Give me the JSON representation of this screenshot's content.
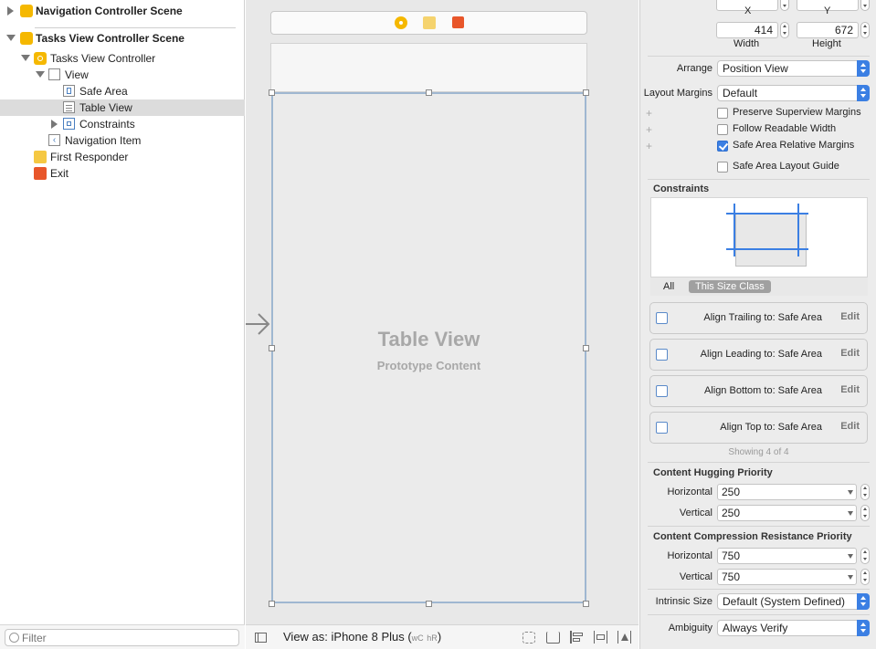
{
  "outline": {
    "items": [
      {
        "label": "Navigation Controller Scene"
      },
      {
        "label": "Tasks View Controller Scene"
      },
      {
        "label": "Tasks View Controller"
      },
      {
        "label": "View"
      },
      {
        "label": "Safe Area"
      },
      {
        "label": "Table View"
      },
      {
        "label": "Constraints"
      },
      {
        "label": "Navigation Item"
      },
      {
        "label": "First Responder"
      },
      {
        "label": "Exit"
      }
    ],
    "filter_placeholder": "Filter"
  },
  "canvas": {
    "table_title": "Table View",
    "table_subtitle": "Prototype Content",
    "view_as_text": "View as: iPhone 8 Plus (",
    "size_w": "wC",
    "size_h": "hR",
    "close_paren": ")"
  },
  "inspector": {
    "x_label": "X",
    "y_label": "Y",
    "width_value": "414",
    "height_value": "672",
    "width_label": "Width",
    "height_label": "Height",
    "arrange_label": "Arrange",
    "arrange_value": "Position View",
    "layout_margins_label": "Layout Margins",
    "layout_margins_value": "Default",
    "checks": [
      {
        "label": "Preserve Superview Margins",
        "checked": false
      },
      {
        "label": "Follow Readable Width",
        "checked": false
      },
      {
        "label": "Safe Area Relative Margins",
        "checked": true
      },
      {
        "label": "Safe Area Layout Guide",
        "checked": false
      }
    ],
    "constraints_header": "Constraints",
    "tab_all": "All",
    "tab_size_class": "This Size Class",
    "constraints": [
      {
        "label": "Align Trailing to:  Safe Area",
        "edit": "Edit"
      },
      {
        "label": "Align Leading to:  Safe Area",
        "edit": "Edit"
      },
      {
        "label": "Align Bottom to:  Safe Area",
        "edit": "Edit"
      },
      {
        "label": "Align Top to:  Safe Area",
        "edit": "Edit"
      }
    ],
    "showing": "Showing 4 of 4",
    "hugging_header": "Content Hugging Priority",
    "compression_header": "Content Compression Resistance Priority",
    "horizontal_label": "Horizontal",
    "vertical_label": "Vertical",
    "hug_h": "250",
    "hug_v": "250",
    "comp_h": "750",
    "comp_v": "750",
    "intrinsic_label": "Intrinsic Size",
    "intrinsic_value": "Default (System Defined)",
    "ambiguity_label": "Ambiguity",
    "ambiguity_value": "Always Verify"
  },
  "colors": {
    "accent": "#3b7fe3",
    "scene_icon": "#f5b800",
    "exit_icon": "#e8562a",
    "selection_border": "#9fb7d1"
  }
}
